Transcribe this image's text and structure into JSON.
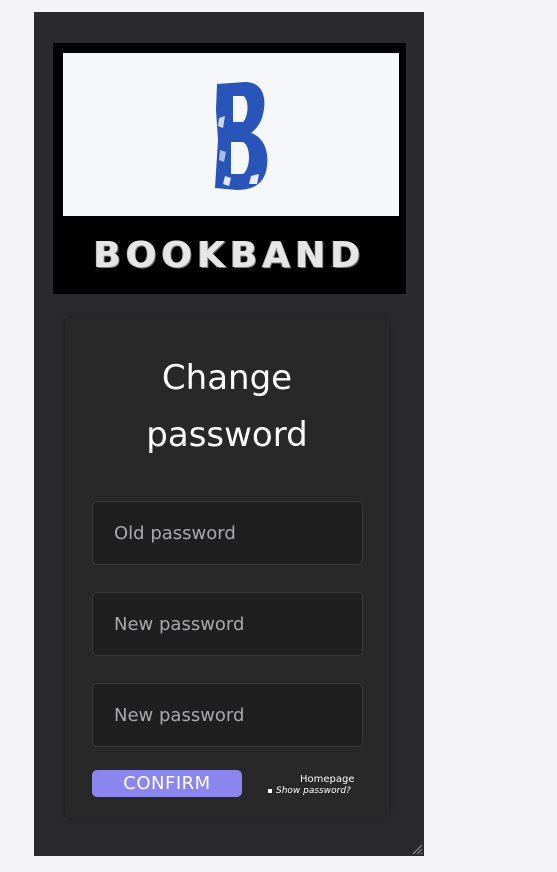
{
  "brand": {
    "logo_letter": "B",
    "logo_wordmark": "BOOKBAND"
  },
  "form": {
    "title": "Change password",
    "fields": [
      {
        "placeholder": "Old password",
        "value": ""
      },
      {
        "placeholder": "New password",
        "value": ""
      },
      {
        "placeholder": "New password",
        "value": ""
      }
    ],
    "confirm_label": "CONFIRM",
    "homepage_link": "Homepage",
    "show_password_label": "Show password?",
    "show_password_checked": false
  },
  "colors": {
    "panel_bg": "#2a2a2c",
    "card_bg": "#282829",
    "field_bg": "#1f1f20",
    "accent": "#8b85ee",
    "logo_blue": "#2a55b8",
    "page_bg": "#f4f4f6"
  },
  "icons": {
    "resize": "resize-grip-icon"
  }
}
